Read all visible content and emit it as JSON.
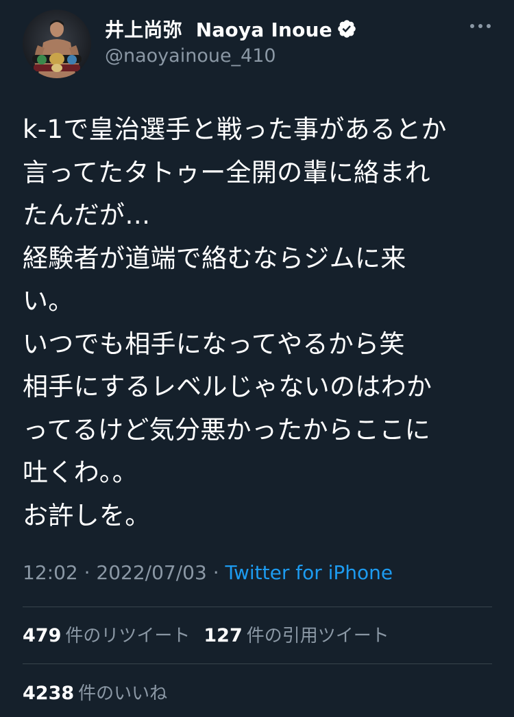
{
  "tweet": {
    "author": {
      "display_name": "井上尚弥  Naoya Inoue",
      "handle": "@naoyainoue_410",
      "verified": true
    },
    "text_lines": [
      "k-1で皇治選手と戦った事があるとか",
      "言ってたタトゥー全開の輩に絡まれ",
      "たんだが…",
      "経験者が道端で絡むならジムに来",
      "い。",
      "いつでも相手になってやるから笑",
      "相手にするレベルじゃないのはわか",
      "ってるけど気分悪かったからここに",
      "吐くわ。。",
      "お許しを。"
    ],
    "time": "12:02",
    "separator": " · ",
    "date": "2022/07/03",
    "source": "Twitter for iPhone",
    "stats": {
      "retweets_count": "479",
      "retweets_label": "件のリツイート",
      "quotes_count": "127",
      "quotes_label": "件の引用ツイート",
      "likes_count": "4238",
      "likes_label": "件のいいね"
    }
  },
  "icons": {
    "verified": "verified-badge-icon",
    "more": "more-options-icon"
  },
  "colors": {
    "background": "#15202b",
    "text_primary": "#ffffff",
    "text_secondary": "#8b98a5",
    "link": "#1d9bf0",
    "divider": "#38444d"
  }
}
